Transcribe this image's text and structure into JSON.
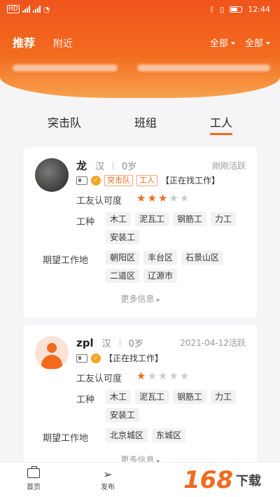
{
  "status_bar": {
    "network_label": "HD",
    "time": "12:44"
  },
  "header": {
    "tabs": [
      "推荐",
      "附近"
    ],
    "filters": [
      "全部",
      "全部"
    ]
  },
  "segments": [
    "突击队",
    "班组",
    "工人"
  ],
  "workers": [
    {
      "name": "龙",
      "ethnicity": "汉",
      "age": "0岁",
      "active": "刚刚活跃",
      "tags": [
        "突击队",
        "工人"
      ],
      "status": "【正在找工作】",
      "rating_label": "工友认可度",
      "rating": 3,
      "rating_max": 5,
      "trade_label": "工种",
      "trades": [
        "木工",
        "泥瓦工",
        "钢筋工",
        "力工",
        "安装工"
      ],
      "area_label": "期望工作地",
      "areas": [
        "朝阳区",
        "丰台区",
        "石景山区",
        "二道区",
        "辽源市"
      ],
      "more": "更多信息"
    },
    {
      "name": "zpl",
      "ethnicity": "汉",
      "age": "0岁",
      "active": "2021-04-12活跃",
      "tags": [],
      "status": "【正在找工作】",
      "rating_label": "工友认可度",
      "rating": 1,
      "rating_max": 5,
      "trade_label": "工种",
      "trades": [
        "木工",
        "泥瓦工",
        "钢筋工",
        "力工",
        "安装工"
      ],
      "area_label": "期望工作地",
      "areas": [
        "北京城区",
        "东城区"
      ],
      "more": "更多信息"
    }
  ],
  "bottom_nav": [
    "首页",
    "发布"
  ],
  "watermark": {
    "logo": "168",
    "text": "下载"
  },
  "colors": {
    "accent": "#f26a1e"
  }
}
